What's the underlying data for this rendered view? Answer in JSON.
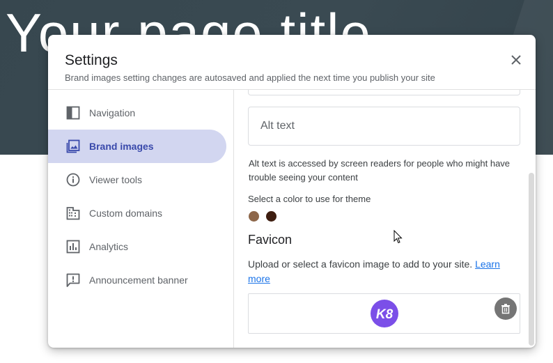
{
  "background": {
    "page_title": "Your page title"
  },
  "dialog": {
    "title": "Settings",
    "subtitle": "Brand images setting changes are autosaved and applied the next time you publish your site",
    "close_icon": "close-icon"
  },
  "sidebar": {
    "items": [
      {
        "label": "Navigation",
        "icon": "navigation-icon",
        "active": false
      },
      {
        "label": "Brand images",
        "icon": "image-icon",
        "active": true
      },
      {
        "label": "Viewer tools",
        "icon": "info-icon",
        "active": false
      },
      {
        "label": "Custom domains",
        "icon": "domain-icon",
        "active": false
      },
      {
        "label": "Analytics",
        "icon": "analytics-icon",
        "active": false
      },
      {
        "label": "Announcement banner",
        "icon": "announcement-icon",
        "active": false
      }
    ]
  },
  "content": {
    "alt_text_placeholder": "Alt text",
    "alt_text_value": "",
    "alt_text_helper": "Alt text is accessed by screen readers for people who might have trouble seeing your content",
    "theme_color_label": "Select a color to use for theme",
    "theme_colors": [
      "#8d6649",
      "#3e1d10"
    ],
    "favicon_title": "Favicon",
    "favicon_desc": "Upload or select a favicon image to add to your site.",
    "favicon_link": "Learn more",
    "favicon_logo_text": "K8",
    "favicon_logo_color": "#7b4fe8"
  },
  "colors": {
    "accent": "#3949ab",
    "active_bg": "#d2d6f0",
    "link": "#1a73e8",
    "header_bg": "#37474f"
  }
}
